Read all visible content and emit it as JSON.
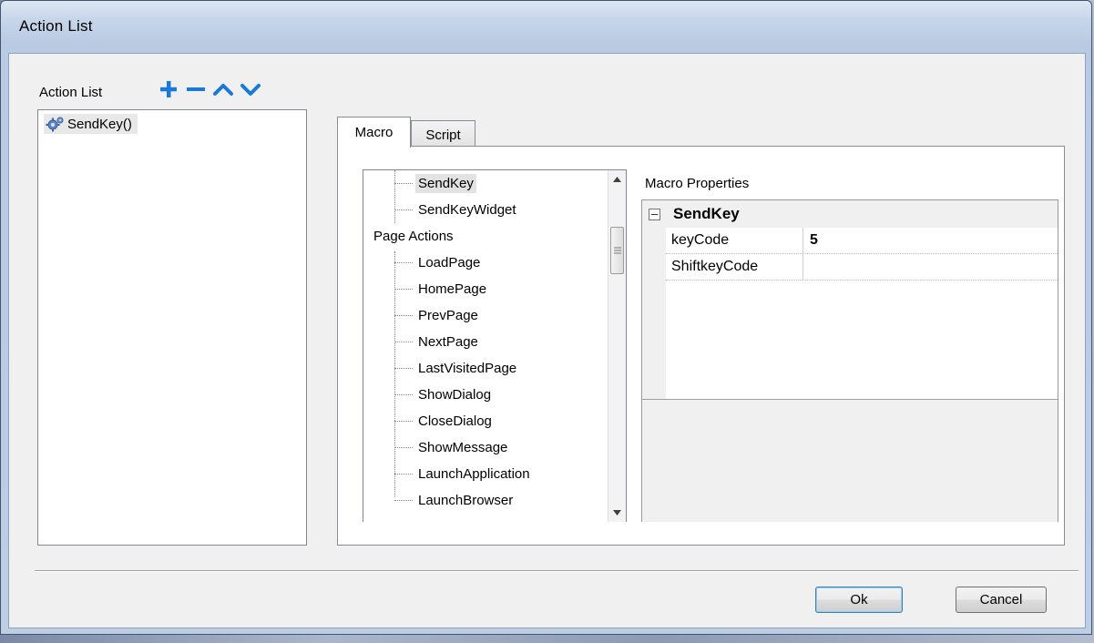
{
  "window": {
    "title": "Action List"
  },
  "action_panel": {
    "label": "Action List",
    "toolbar": [
      {
        "name": "add-action-button",
        "icon": "plus-icon"
      },
      {
        "name": "remove-action-button",
        "icon": "minus-icon"
      },
      {
        "name": "move-up-button",
        "icon": "chevron-up-icon"
      },
      {
        "name": "move-down-button",
        "icon": "chevron-down-icon"
      }
    ],
    "items": [
      {
        "label": "SendKey()",
        "icon": "gears-icon"
      }
    ]
  },
  "tabs": [
    {
      "label": "Macro",
      "active": true
    },
    {
      "label": "Script",
      "active": false
    }
  ],
  "macro_tree": {
    "items": [
      {
        "label": "SendKey",
        "level": 1,
        "selected": true
      },
      {
        "label": "SendKeyWidget",
        "level": 1
      },
      {
        "label": "Page Actions",
        "level": 0
      },
      {
        "label": "LoadPage",
        "level": 1
      },
      {
        "label": "HomePage",
        "level": 1
      },
      {
        "label": "PrevPage",
        "level": 1
      },
      {
        "label": "NextPage",
        "level": 1
      },
      {
        "label": "LastVisitedPage",
        "level": 1
      },
      {
        "label": "ShowDialog",
        "level": 1
      },
      {
        "label": "CloseDialog",
        "level": 1
      },
      {
        "label": "ShowMessage",
        "level": 1
      },
      {
        "label": "LaunchApplication",
        "level": 1
      },
      {
        "label": "LaunchBrowser",
        "level": 1
      }
    ]
  },
  "macro_properties": {
    "label": "Macro Properties",
    "category": "SendKey",
    "rows": [
      {
        "name": "keyCode",
        "value": "5"
      },
      {
        "name": "ShiftkeyCode",
        "value": ""
      }
    ]
  },
  "buttons": {
    "ok": "Ok",
    "cancel": "Cancel"
  },
  "colors": {
    "accent_blue": "#1a78d6",
    "selection_gray": "#e2e2e2"
  }
}
